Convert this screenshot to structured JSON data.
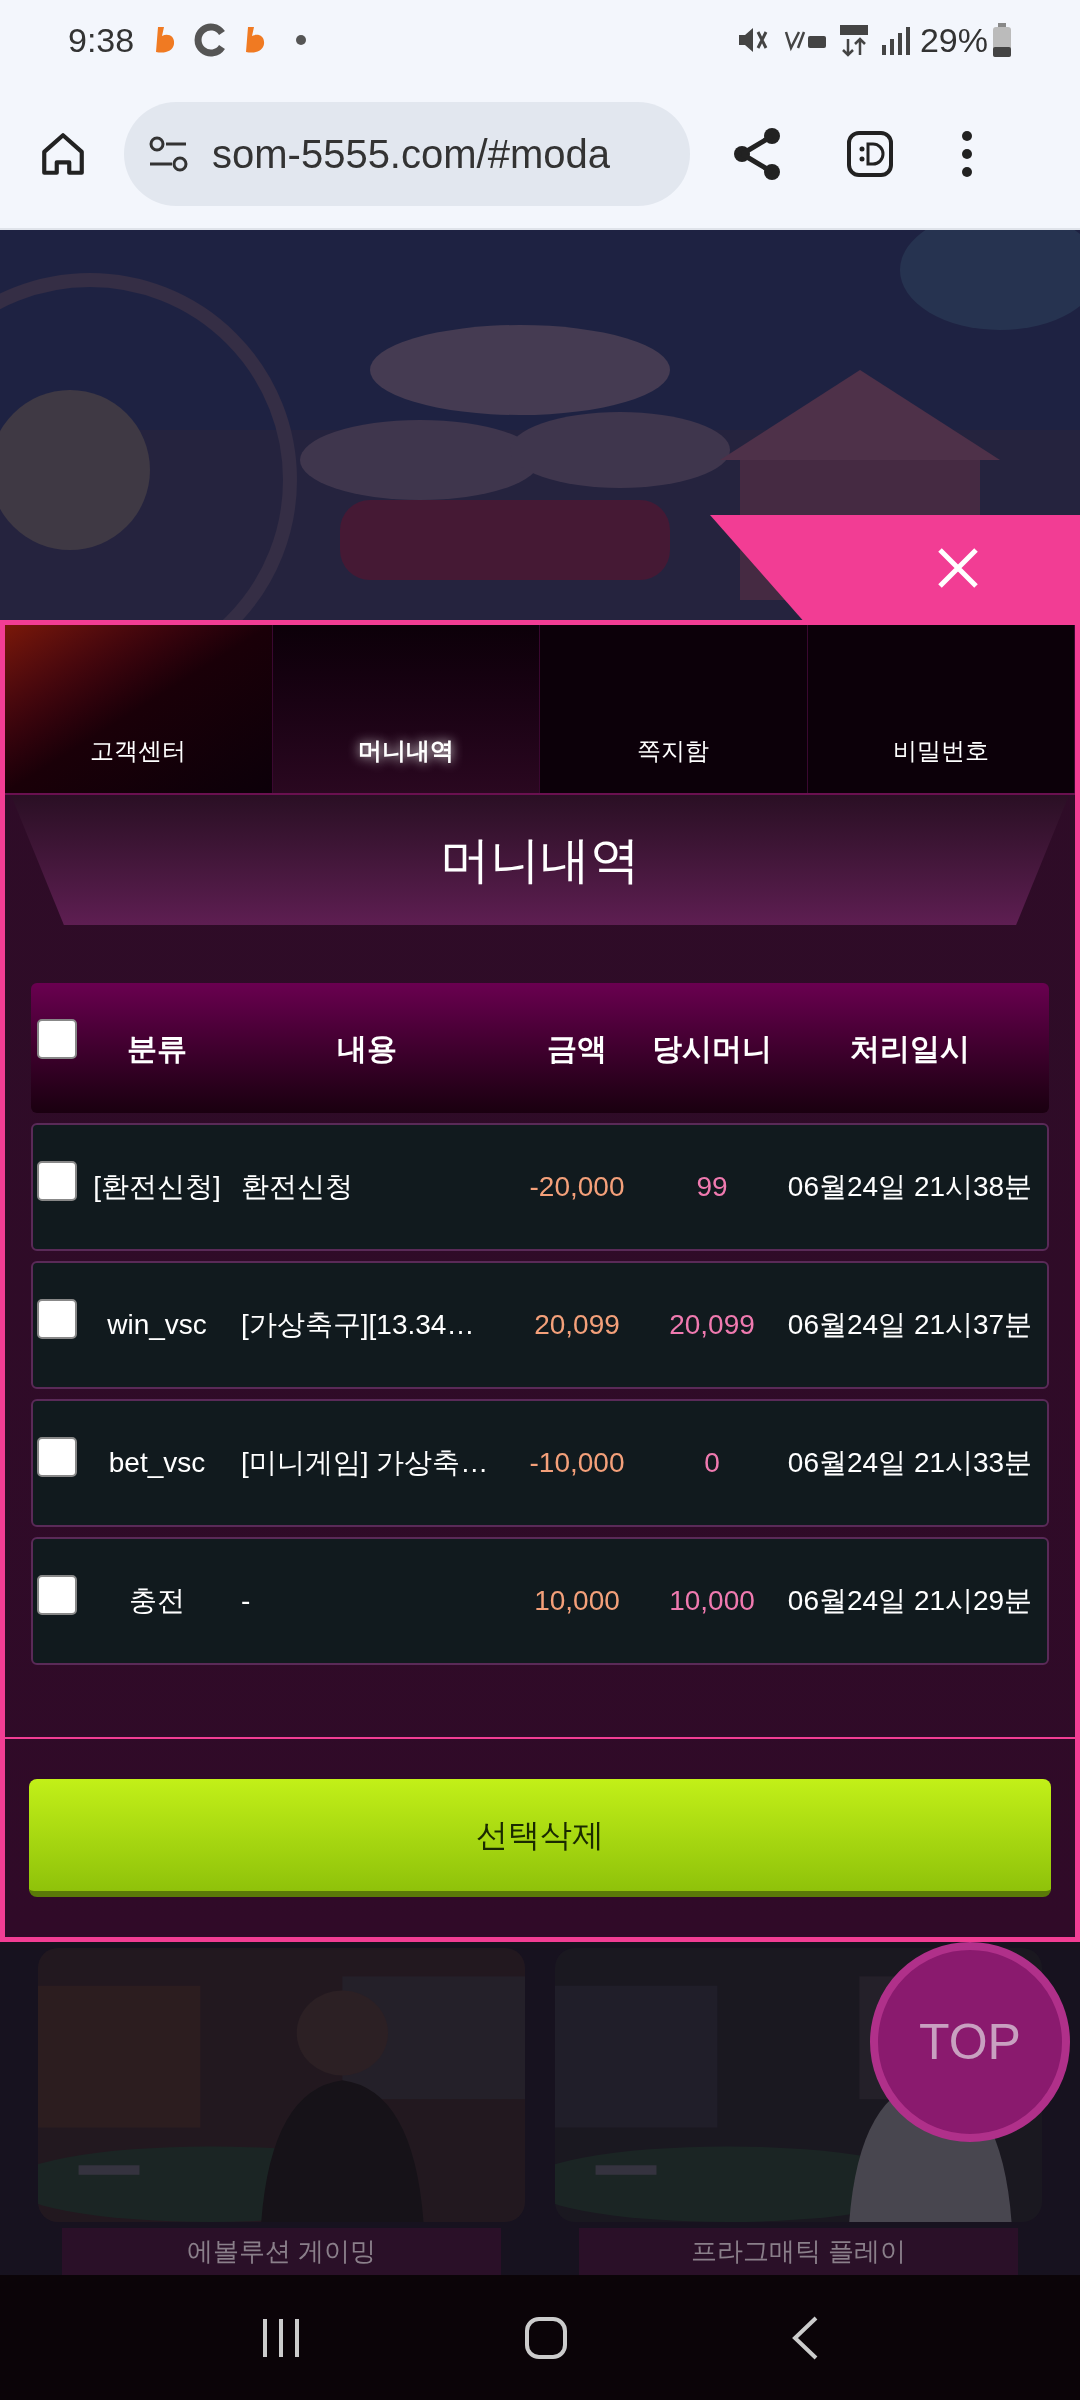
{
  "status_bar": {
    "time": "9:38",
    "battery": "29%"
  },
  "browser": {
    "url": "som-5555.com/#moda"
  },
  "modal": {
    "tabs": [
      {
        "label": "고객센터",
        "selected": false
      },
      {
        "label": "머니내역",
        "selected": true
      },
      {
        "label": "쪽지함",
        "selected": false
      },
      {
        "label": "비밀번호",
        "selected": false
      }
    ],
    "heading": "머니내역",
    "table": {
      "select_all_checked": false,
      "columns": [
        "분류",
        "내용",
        "금액",
        "당시머니",
        "처리일시"
      ],
      "rows": [
        {
          "checked": false,
          "category": "[환전신청]",
          "content": "환전신청",
          "amount": "-20,000",
          "balance": "99",
          "time": "06월24일 21시38분"
        },
        {
          "checked": false,
          "category": "win_vsc",
          "content": "[가상축구][13.34…",
          "amount": "20,099",
          "balance": "20,099",
          "time": "06월24일 21시37분"
        },
        {
          "checked": false,
          "category": "bet_vsc",
          "content": "[미니게임] 가상축…",
          "amount": "-10,000",
          "balance": "0",
          "time": "06월24일 21시33분"
        },
        {
          "checked": false,
          "category": "충전",
          "content": "-",
          "amount": "10,000",
          "balance": "10,000",
          "time": "06월24일 21시29분"
        }
      ]
    },
    "delete_button": "선택삭제"
  },
  "background": {
    "cards": [
      {
        "caption": "에볼루션 게이밍"
      },
      {
        "caption": "프라그매틱 플레이"
      }
    ],
    "top_button": "TOP"
  }
}
